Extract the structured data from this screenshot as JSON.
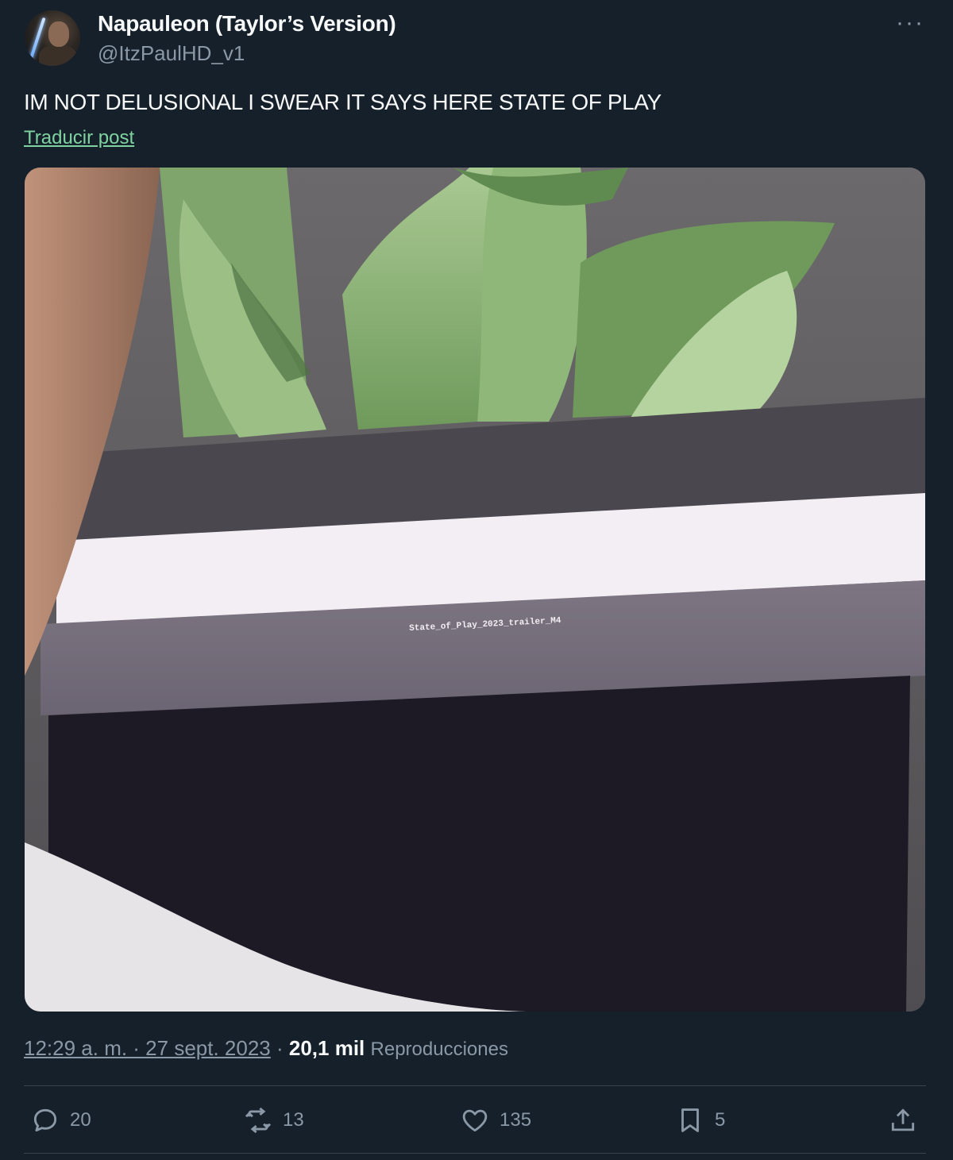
{
  "author": {
    "display_name": "Napauleon (Taylor’s Version)",
    "handle": "@ItzPaulHD_v1"
  },
  "more_icon": "more-horizontal-icon",
  "post": {
    "text": "IM NOT DELUSIONAL I SWEAR IT SAYS HERE STATE OF PLAY",
    "translate_label": "Traducir post"
  },
  "media": {
    "screen_text": "State_of_Play_2023_trailer_M4"
  },
  "meta": {
    "time": "12:29 a. m. · 27 sept. 2023",
    "separator": " · ",
    "views_count": "20,1 mil",
    "views_label": "Reproducciones"
  },
  "actions": {
    "replies": "20",
    "reposts": "13",
    "likes": "135",
    "bookmarks": "5"
  },
  "colors": {
    "background": "#15202b",
    "text_primary": "#f7f9f9",
    "text_secondary": "#8b98a5",
    "link": "#7fd3a0",
    "divider": "#38444d"
  }
}
